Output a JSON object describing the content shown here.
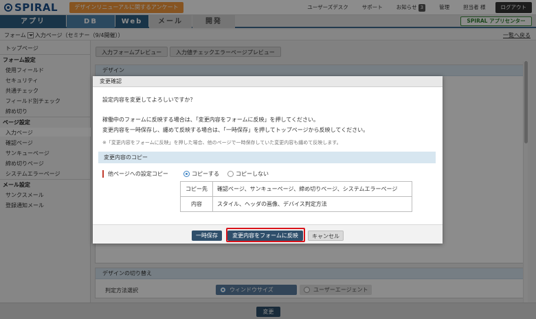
{
  "header": {
    "logo_text": "SPIRAL",
    "survey_banner": "デザインリニューアルに関するアンケート",
    "links": {
      "user_desk": "ユーザーズデスク",
      "support": "サポート",
      "notices": "お知らせ",
      "notices_count": "3",
      "admin": "管理",
      "user": "担当者 様",
      "logout": "ログアウト"
    }
  },
  "nav": {
    "tabs": [
      "アプリ",
      "DB",
      "Web",
      "メール",
      "開発"
    ],
    "app_center": "SPIRAL アプリセンター"
  },
  "breadcrumb": {
    "root": "フォーム",
    "page": "入力ページ（セミナー（9/4開催））",
    "back": "一覧へ戻る"
  },
  "sidebar": {
    "top": "トップページ",
    "form_settings": {
      "heading": "フォーム設定",
      "items": [
        "使用フィールド",
        "セキュリティ",
        "共通チェック",
        "フィールド別チェック",
        "締め切り"
      ]
    },
    "page_settings": {
      "heading": "ページ設定",
      "items": [
        "入力ページ",
        "確認ページ",
        "サンキューページ",
        "締め切りページ",
        "システムエラーページ"
      ]
    },
    "mail_settings": {
      "heading": "メール設定",
      "items": [
        "サンクスメール",
        "登録通知メール"
      ]
    }
  },
  "main": {
    "preview_button": "入力フォームプレビュー",
    "error_preview_button": "入力値チェックエラーページプレビュー",
    "design_panel_title": "デザイン",
    "design_switch_title": "デザインの切り替え",
    "judge_method_label": "判定方法選択",
    "judge_options": [
      "ウィンドウサイズ",
      "ユーザーエージェント"
    ],
    "change_button": "変更"
  },
  "modal": {
    "title": "変更確認",
    "question": "設定内容を変更してよろしいですか？",
    "line1": "稼働中のフォームに反映する場合は、「変更内容をフォームに反映」を押してください。",
    "line2": "変更内容を一時保存し、纏めて反映する場合は、「一時保存」を押してトップページから反映してください。",
    "note": "※「変更内容をフォームに反映」を押した場合、他のページで一時保存していた変更内容も纏めて反映します。",
    "copy_section": "変更内容のコピー",
    "copy_setting_label": "他ページへの設定コピー",
    "copy_options": [
      "コピーする",
      "コピーしない"
    ],
    "table": [
      {
        "key": "コピー先",
        "value": "確認ページ、サンキューページ、締め切りページ、システムエラーページ"
      },
      {
        "key": "内容",
        "value": "スタイル、ヘッダの画像、デバイス判定方法"
      }
    ],
    "buttons": {
      "temp_save": "一時保存",
      "apply": "変更内容をフォームに反映",
      "cancel": "キャンセル"
    }
  }
}
